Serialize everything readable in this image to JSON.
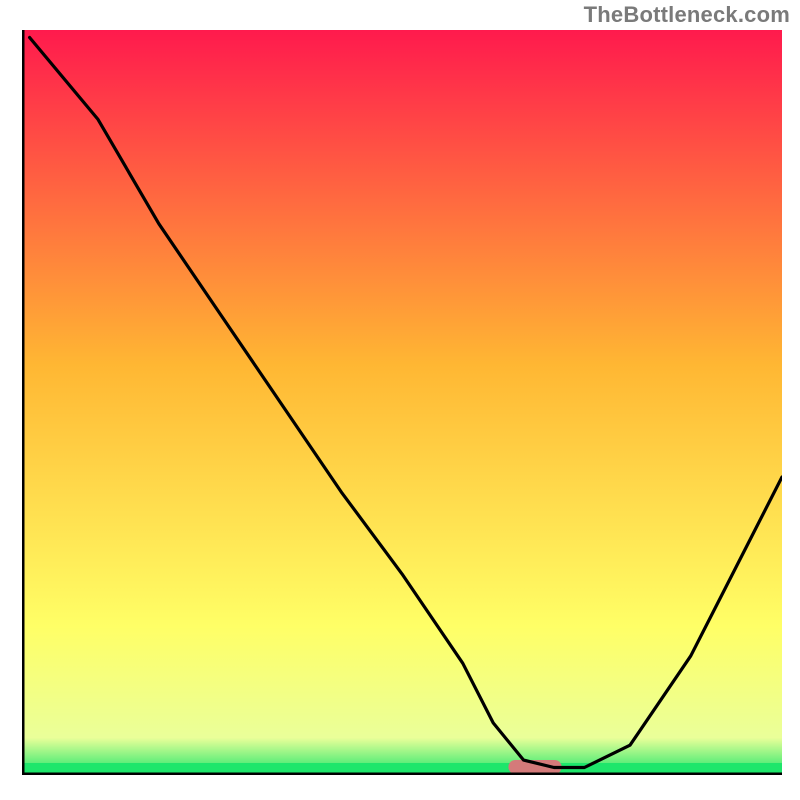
{
  "watermark": "TheBottleneck.com",
  "chart_data": {
    "type": "line",
    "title": "",
    "xlabel": "",
    "ylabel": "",
    "xlim": [
      0,
      100
    ],
    "ylim": [
      0,
      100
    ],
    "grid": false,
    "legend": false,
    "background_gradient": {
      "top_color": "#ff1a4d",
      "mid_color": "#ffb733",
      "lower_color": "#ffff66",
      "bottom_band_color": "#1ee66b"
    },
    "marker_band": {
      "fill": "#d47a7a",
      "x_range": [
        64,
        71
      ],
      "y": 0
    },
    "series": [
      {
        "name": "curve",
        "color": "#000000",
        "x": [
          1,
          10,
          18,
          26,
          34,
          42,
          50,
          58,
          62,
          66,
          70,
          74,
          80,
          88,
          96,
          100
        ],
        "y": [
          99,
          88,
          74,
          62,
          50,
          38,
          27,
          15,
          7,
          2,
          1,
          1,
          4,
          16,
          32,
          40
        ]
      }
    ]
  }
}
